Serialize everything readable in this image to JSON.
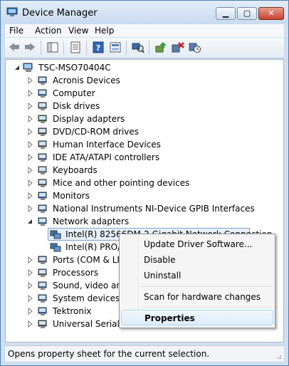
{
  "window": {
    "title": "Device Manager",
    "buttons": {
      "minimize": "▁",
      "maximize": "▢",
      "close": "✕"
    }
  },
  "menu": [
    "File",
    "Action",
    "View",
    "Help"
  ],
  "toolbar": {
    "icons": [
      "back-icon",
      "forward-icon",
      "show-hide-console-tree-icon",
      "properties-icon",
      "help-icon",
      "show-view-icon",
      "scan-hardware-changes-icon",
      "update-driver-icon",
      "uninstall-icon",
      "disable-icon"
    ]
  },
  "tree": {
    "root": "TSC-MSO70404C",
    "categories": [
      {
        "label": "Acronis Devices",
        "icon": "device-icon"
      },
      {
        "label": "Computer",
        "icon": "computer-icon"
      },
      {
        "label": "Disk drives",
        "icon": "disk-drive-icon"
      },
      {
        "label": "Display adapters",
        "icon": "display-adapter-icon"
      },
      {
        "label": "DVD/CD-ROM drives",
        "icon": "dvd-drive-icon"
      },
      {
        "label": "Human Interface Devices",
        "icon": "hid-icon"
      },
      {
        "label": "IDE ATA/ATAPI controllers",
        "icon": "ide-controller-icon"
      },
      {
        "label": "Keyboards",
        "icon": "keyboard-icon"
      },
      {
        "label": "Mice and other pointing devices",
        "icon": "mouse-icon"
      },
      {
        "label": "Monitors",
        "icon": "monitor-icon"
      },
      {
        "label": "National Instruments NI-Device GPIB Interfaces",
        "icon": "gpib-icon"
      },
      {
        "label": "Network adapters",
        "icon": "network-adapter-icon",
        "expanded": true
      },
      {
        "label": "Ports (COM & LPT)",
        "icon": "port-icon"
      },
      {
        "label": "Processors",
        "icon": "processor-icon"
      },
      {
        "label": "Sound, video and game controllers",
        "icon": "sound-icon"
      },
      {
        "label": "System devices",
        "icon": "system-device-icon"
      },
      {
        "label": "Tektronix",
        "icon": "device-icon"
      },
      {
        "label": "Universal Serial Bus controllers",
        "icon": "usb-icon"
      }
    ],
    "network_children": [
      {
        "label": "Intel(R) 82566DM-2 Gigabit Network Connection",
        "selected": true
      },
      {
        "label": "Intel(R) PRO/1000 GT Desktop Adapter"
      }
    ]
  },
  "context_menu": {
    "items": [
      {
        "label": "Update Driver Software...",
        "bold": false,
        "highlighted": false
      },
      {
        "label": "Disable",
        "bold": false,
        "highlighted": false
      },
      {
        "label": "Uninstall",
        "bold": false,
        "highlighted": false
      },
      {
        "label": "Scan for hardware changes",
        "bold": false,
        "highlighted": false
      },
      {
        "label": "Properties",
        "bold": true,
        "highlighted": true
      }
    ]
  },
  "status": {
    "text": "Opens property sheet for the current selection."
  },
  "colors": {
    "selection_border": "#7da2ce",
    "menu_highlight": "#dcecfa",
    "title_bar": "#c8daee",
    "close_button": "#c8402a"
  }
}
